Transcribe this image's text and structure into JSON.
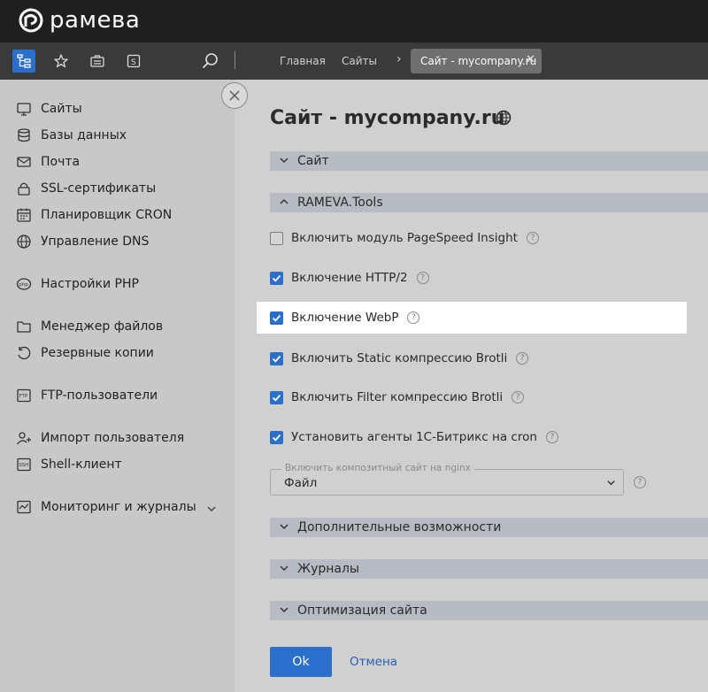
{
  "brand": {
    "name": "рамева"
  },
  "breadcrumb": {
    "items": [
      "Главная",
      "Сайты"
    ],
    "active_tab": "Сайт - mycompany.ru"
  },
  "sidebar": {
    "items": [
      {
        "label": "Сайты",
        "icon": "sites-icon"
      },
      {
        "label": "Базы данных",
        "icon": "database-icon"
      },
      {
        "label": "Почта",
        "icon": "mail-icon"
      },
      {
        "label": "SSL-сертификаты",
        "icon": "lock-icon"
      },
      {
        "label": "Планировщик CRON",
        "icon": "calendar-icon"
      },
      {
        "label": "Управление DNS",
        "icon": "globe-icon"
      },
      {
        "label": "Настройки PHP",
        "icon": "php-icon"
      },
      {
        "label": "Менеджер файлов",
        "icon": "folder-icon"
      },
      {
        "label": "Резервные копии",
        "icon": "backup-icon"
      },
      {
        "label": "FTP-пользователи",
        "icon": "ftp-icon"
      },
      {
        "label": "Импорт пользователя",
        "icon": "user-import-icon"
      },
      {
        "label": "Shell-клиент",
        "icon": "ssh-icon"
      },
      {
        "label": "Мониторинг и журналы",
        "icon": "monitoring-icon"
      }
    ]
  },
  "page": {
    "title": "Сайт - mycompany.ru"
  },
  "sections": {
    "site": "Сайт",
    "tools": "RAMEVA.Tools",
    "extra": "Дополнительные возможности",
    "logs": "Журналы",
    "optimization": "Оптимизация сайта"
  },
  "options": [
    {
      "label": "Включить модуль PageSpeed Insight",
      "checked": false
    },
    {
      "label": "Включение HTTP/2",
      "checked": true
    },
    {
      "label": "Включение WebP",
      "checked": true
    },
    {
      "label": "Включить Static компрессию Brotli",
      "checked": true
    },
    {
      "label": "Включить Filter компрессию Brotli",
      "checked": true
    },
    {
      "label": "Установить агенты 1С-Битрикс на cron",
      "checked": true
    }
  ],
  "composite_select": {
    "legend": "Включить композитный сайт на nginx",
    "value": "Файл"
  },
  "help_glyph": "?",
  "buttons": {
    "ok": "Ok",
    "cancel": "Отмена"
  },
  "colors": {
    "accent": "#2a6fc9",
    "topbar": "#1f1f1f",
    "toolbar": "#3a3a3a",
    "section_bar": "#b7bcc2"
  }
}
